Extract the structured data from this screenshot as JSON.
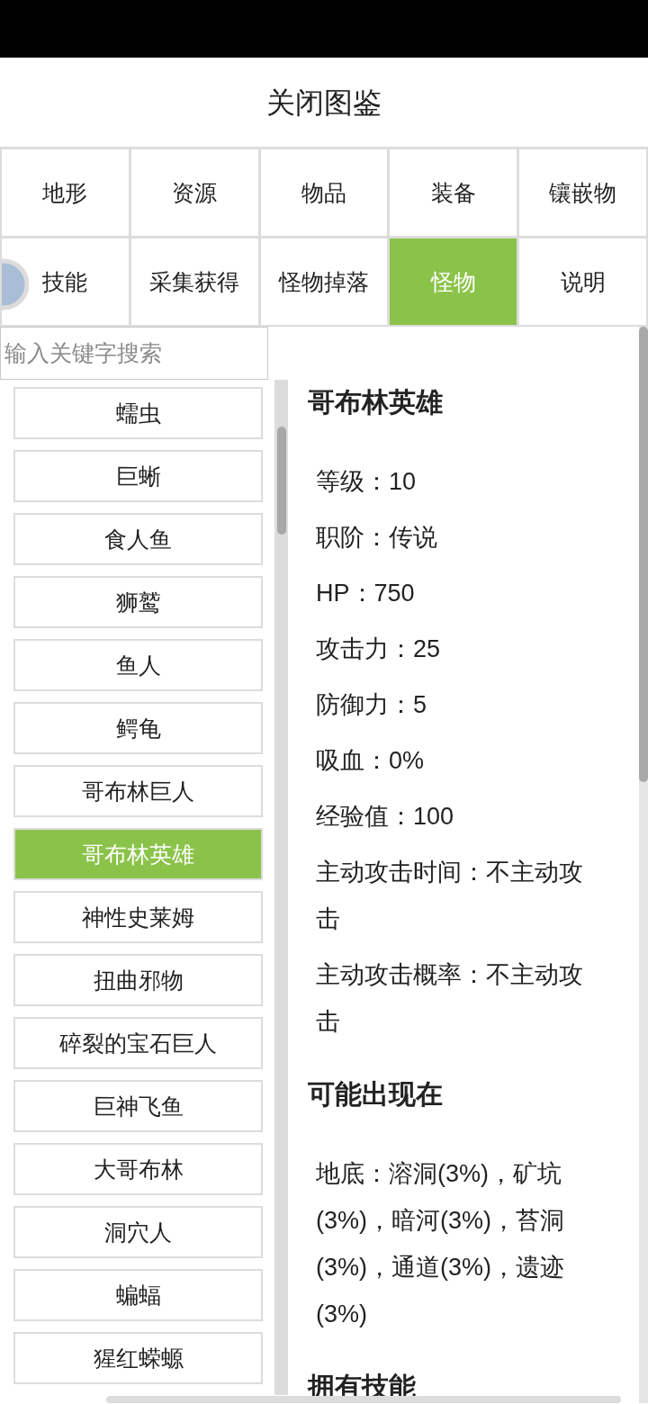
{
  "header": {
    "title": "关闭图鉴"
  },
  "tabs": [
    {
      "label": "地形",
      "selected": false
    },
    {
      "label": "资源",
      "selected": false
    },
    {
      "label": "物品",
      "selected": false
    },
    {
      "label": "装备",
      "selected": false
    },
    {
      "label": "镶嵌物",
      "selected": false
    },
    {
      "label": "技能",
      "selected": false
    },
    {
      "label": "采集获得",
      "selected": false
    },
    {
      "label": "怪物掉落",
      "selected": false
    },
    {
      "label": "怪物",
      "selected": true
    },
    {
      "label": "说明",
      "selected": false
    }
  ],
  "search": {
    "placeholder": "输入关键字搜索"
  },
  "monster_list": [
    {
      "name": "蠕虫",
      "selected": false
    },
    {
      "name": "巨蜥",
      "selected": false
    },
    {
      "name": "食人鱼",
      "selected": false
    },
    {
      "name": "狮鹫",
      "selected": false
    },
    {
      "name": "鱼人",
      "selected": false
    },
    {
      "name": "鳄龟",
      "selected": false
    },
    {
      "name": "哥布林巨人",
      "selected": false
    },
    {
      "name": "哥布林英雄",
      "selected": true
    },
    {
      "name": "神性史莱姆",
      "selected": false
    },
    {
      "name": "扭曲邪物",
      "selected": false
    },
    {
      "name": "碎裂的宝石巨人",
      "selected": false
    },
    {
      "name": "巨神飞鱼",
      "selected": false
    },
    {
      "name": "大哥布林",
      "selected": false
    },
    {
      "name": "洞穴人",
      "selected": false
    },
    {
      "name": "蝙蝠",
      "selected": false
    },
    {
      "name": "猩红蝾螈",
      "selected": false
    }
  ],
  "detail": {
    "title": "哥布林英雄",
    "stats": [
      "等级：10",
      "职阶：传说",
      "HP：750",
      "攻击力：25",
      "防御力：5",
      "吸血：0%",
      "经验值：100",
      "主动攻击时间：不主动攻击",
      "主动攻击概率：不主动攻击"
    ],
    "sections": [
      {
        "heading": "可能出现在",
        "lines": [
          "地底：溶洞(3%)，矿坑(3%)，暗河(3%)，苔洞(3%)，通道(3%)，遗迹(3%)"
        ]
      },
      {
        "heading": "拥有技能"
      }
    ]
  }
}
